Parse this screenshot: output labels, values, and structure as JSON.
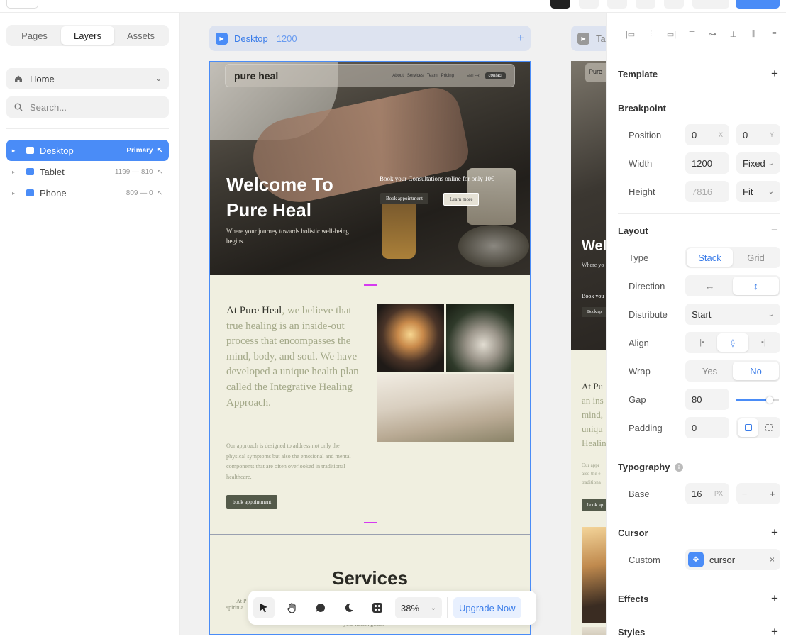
{
  "left_panel": {
    "tabs": [
      "Pages",
      "Layers",
      "Assets"
    ],
    "active_tab": "Layers",
    "page_select": {
      "label": "Home"
    },
    "search": {
      "placeholder": "Search..."
    },
    "breakpoints": [
      {
        "name": "Desktop",
        "meta": "Primary",
        "active": true
      },
      {
        "name": "Tablet",
        "meta": "1199 — 810",
        "active": false
      },
      {
        "name": "Phone",
        "meta": "809 — 0",
        "active": false
      }
    ]
  },
  "canvas": {
    "desktop_frame": {
      "label": "Desktop",
      "width": "1200"
    },
    "tablet_frame": {
      "label": "Ta"
    },
    "site": {
      "logo": "pure heal",
      "nav_links": [
        "About",
        "Services",
        "Team",
        "Pricing"
      ],
      "lang": "EN | FR",
      "contact": "contact",
      "hero_title": "Welcome To Pure Heal",
      "hero_sub": "Where your journey towards holistic well-being begins.",
      "hero_book": "Book your Consultations online for only  10€",
      "hero_btn1": "Book appointment",
      "hero_btn2": "Learn more",
      "about_lead_dark": "At Pure Heal",
      "about_lead_rest": ", we believe that true healing is an inside-out process that encompasses the mind, body, and soul. We have developed a unique health plan called the Integrative Healing Approach.",
      "about_body": "Our approach is designed to address not only the physical symptoms but also the emotional and mental components that are often overlooked in traditional healthcare.",
      "about_btn": "book appointment",
      "services_title": "Services",
      "services_sub1": "At P",
      "services_sub1b": "spiritua",
      "services_sub2": "your health goals."
    },
    "tablet_preview": {
      "logo": "Pure",
      "hero": "Wel",
      "hero_sub": "Where yo",
      "book": "Book you",
      "btn": "Book ap",
      "about_lines": [
        "At Pu",
        "an ins",
        "mind,",
        "uniqu",
        "Healin"
      ],
      "body_lines": [
        "Our appr",
        "also the e",
        "traditiona"
      ],
      "about_btn": "book ap"
    }
  },
  "toolbar": {
    "tools": [
      "select-tool",
      "hand-tool",
      "comment-tool",
      "theme-tool",
      "components-tool"
    ],
    "zoom": "38%",
    "upgrade": "Upgrade Now"
  },
  "right_panel": {
    "template": {
      "title": "Template"
    },
    "breakpoint": {
      "title": "Breakpoint",
      "position_label": "Position",
      "pos_x": "0",
      "pos_x_unit": "X",
      "pos_y": "0",
      "pos_y_unit": "Y",
      "width_label": "Width",
      "width": "1200",
      "width_mode": "Fixed",
      "height_label": "Height",
      "height": "7816",
      "height_mode": "Fit"
    },
    "layout": {
      "title": "Layout",
      "type_label": "Type",
      "type_options": [
        "Stack",
        "Grid"
      ],
      "type_active": "Stack",
      "direction_label": "Direction",
      "distribute_label": "Distribute",
      "distribute": "Start",
      "align_label": "Align",
      "wrap_label": "Wrap",
      "wrap_options": [
        "Yes",
        "No"
      ],
      "wrap_active": "No",
      "gap_label": "Gap",
      "gap": "80",
      "padding_label": "Padding",
      "padding": "0"
    },
    "typography": {
      "title": "Typography",
      "base_label": "Base",
      "base": "16",
      "base_unit": "PX"
    },
    "cursor": {
      "title": "Cursor",
      "custom_label": "Custom",
      "custom_value": "cursor"
    },
    "effects": {
      "title": "Effects"
    },
    "styles": {
      "title": "Styles"
    }
  },
  "colors": {
    "accent": "#4a8cf7",
    "guide": "#d63af0",
    "site_bg": "#f0efe0"
  }
}
